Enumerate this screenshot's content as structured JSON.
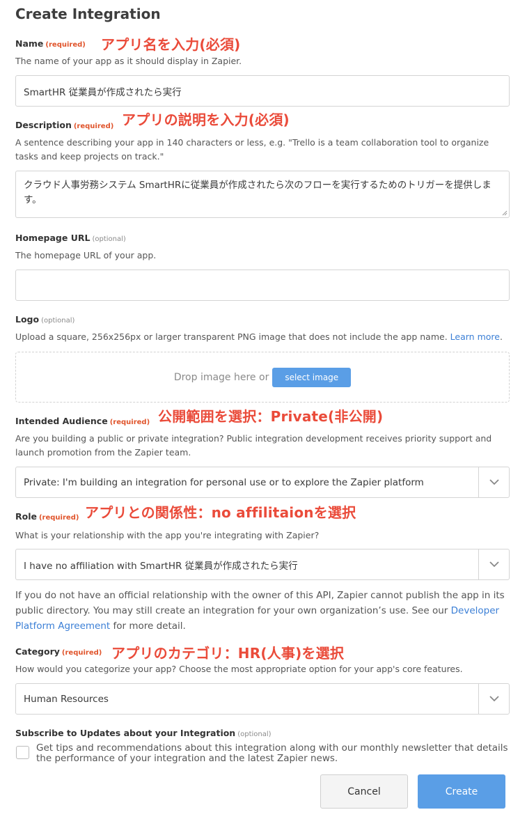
{
  "page_title": "Create Integration",
  "name": {
    "label": "Name",
    "badge": "(required)",
    "help": "The name of your app as it should display in Zapier.",
    "value": "SmartHR 従業員が作成されたら実行",
    "annotation": "アプリ名を入力(必須)"
  },
  "description": {
    "label": "Description",
    "badge": "(required)",
    "help": "A sentence describing your app in 140 characters or less, e.g. \"Trello is a team collaboration tool to organize tasks and keep projects on track.\"",
    "value": "クラウド人事労務システム SmartHRに従業員が作成されたら次のフローを実行するためのトリガーを提供します。",
    "annotation": "アプリの説明を入力(必須)"
  },
  "homepage": {
    "label": "Homepage URL",
    "badge": "(optional)",
    "help": "The homepage URL of your app.",
    "value": ""
  },
  "logo": {
    "label": "Logo",
    "badge": "(optional)",
    "help": "Upload a square, 256x256px or larger transparent PNG image that does not include the app name.",
    "help_link": "Learn more",
    "help_end": ".",
    "drop_text": "Drop image here or",
    "select_label": "select image"
  },
  "audience": {
    "label": "Intended Audience",
    "badge": "(required)",
    "help": "Are you building a public or private integration? Public integration development receives priority support and launch promotion from the Zapier team.",
    "value": "Private: I'm building an integration for personal use or to explore the Zapier platform",
    "annotation": "公開範囲を選択：Private(非公開)"
  },
  "role": {
    "label": "Role",
    "badge": "(required)",
    "help": "What is your relationship with the app you're integrating with Zapier?",
    "value": "I have no affiliation with SmartHR 従業員が作成されたら実行",
    "note": "If you do not have an official relationship with the owner of this API, Zapier cannot publish the app in its public directory. You may still create an integration for your own organization’s use. See our",
    "note_link": "Developer Platform Agreement",
    "note_end": "for more detail.",
    "annotation": "アプリとの関係性：no affilitaionを選択"
  },
  "category": {
    "label": "Category",
    "badge": "(required)",
    "help": "How would you categorize your app? Choose the most appropriate option for your app's core features.",
    "value": "Human Resources",
    "annotation": "アプリのカテゴリ：HR(人事)を選択"
  },
  "subscribe": {
    "label": "Subscribe to Updates about your Integration",
    "badge": "(optional)",
    "text": "Get tips and recommendations about this integration along with our monthly newsletter that details the performance of your integration and the latest Zapier news.",
    "checked": false
  },
  "buttons": {
    "cancel": "Cancel",
    "create": "Create"
  },
  "colors": {
    "annotation": "#ea4b3a",
    "required": "#e0542b",
    "primary": "#5a9ee6",
    "link": "#3b7fd6"
  }
}
